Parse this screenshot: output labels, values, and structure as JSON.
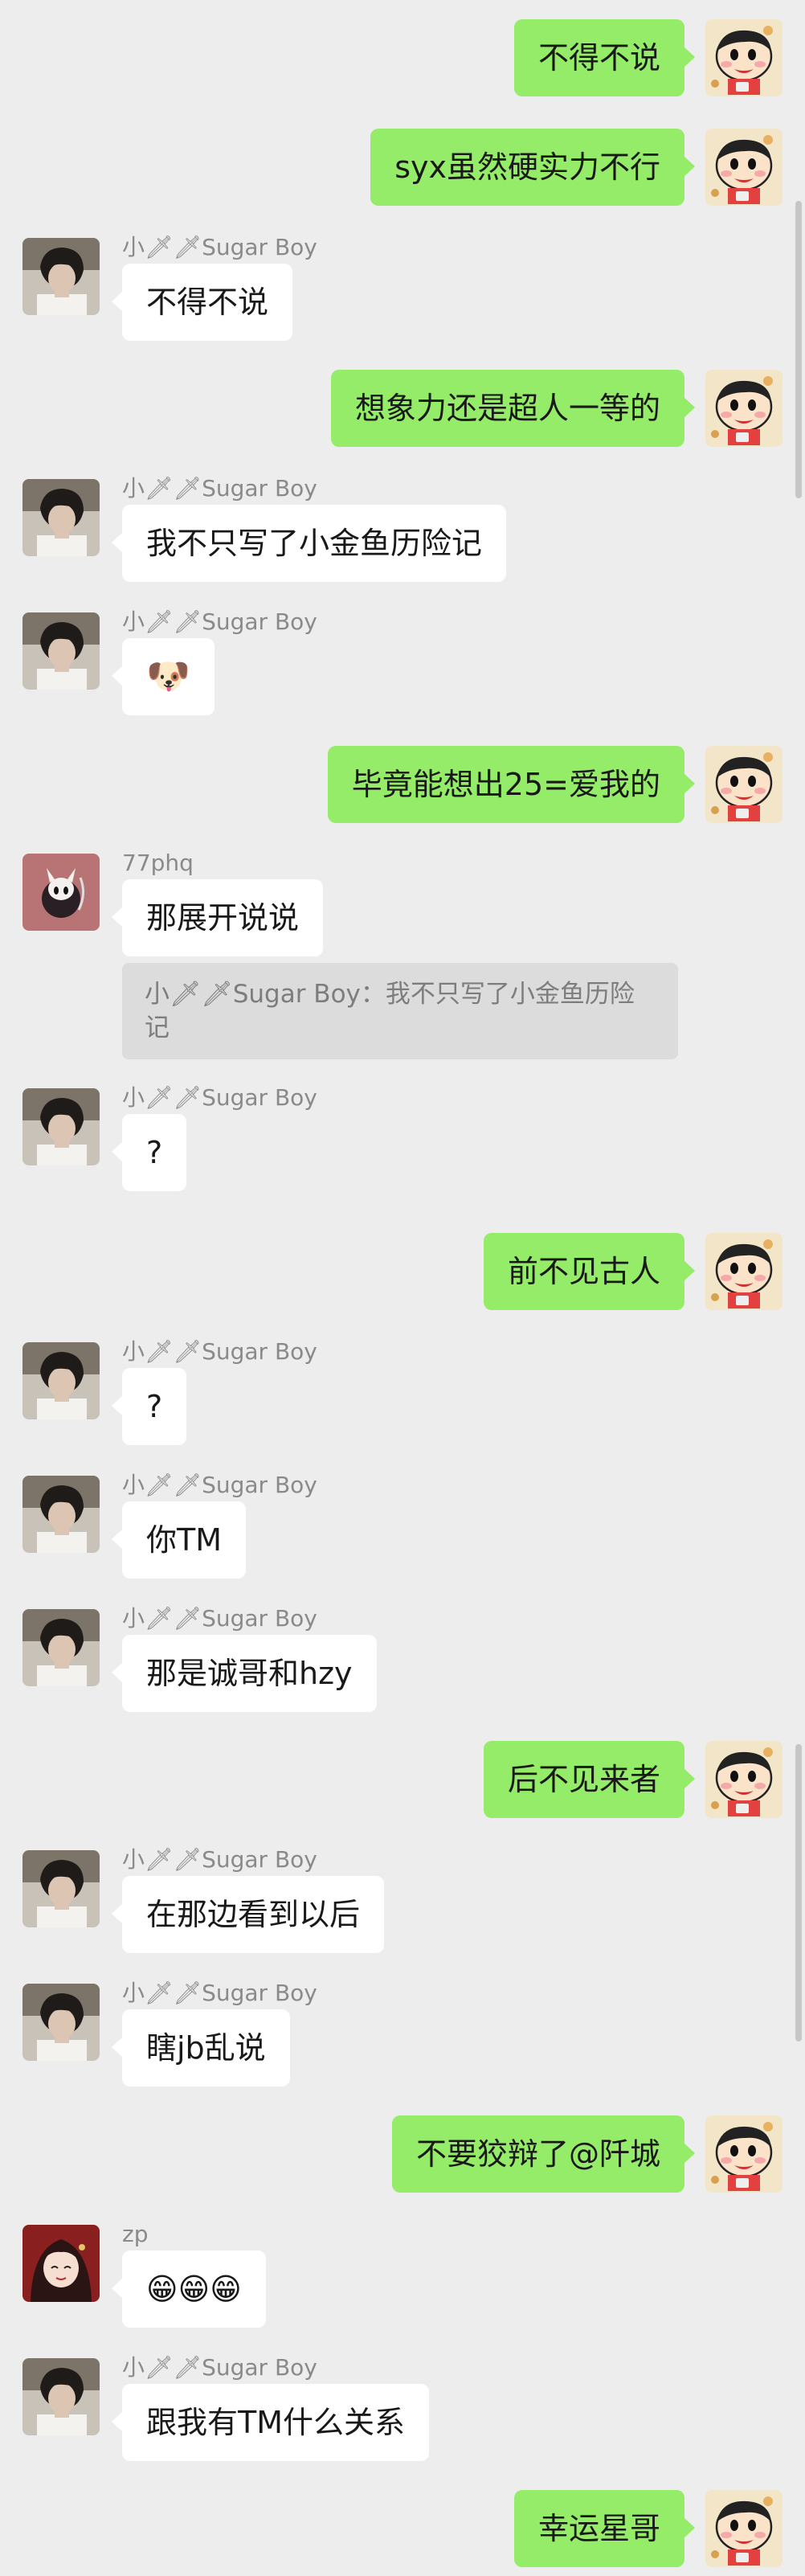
{
  "colors": {
    "background": "#ededed",
    "outgoing_bubble": "#95ec69",
    "incoming_bubble": "#ffffff",
    "name_text": "#8a8a8a"
  },
  "messages": [
    {
      "side": "right",
      "text": "不得不说"
    },
    {
      "side": "right",
      "text": "syx虽然硬实力不行"
    },
    {
      "side": "left",
      "sender": "小🗡🗡Sugar Boy",
      "text": "不得不说"
    },
    {
      "side": "right",
      "text": "想象力还是超人一等的"
    },
    {
      "side": "left",
      "sender": "小🗡🗡Sugar Boy",
      "text": "我不只写了小金鱼历险记"
    },
    {
      "side": "left",
      "sender": "小🗡🗡Sugar Boy",
      "text": "🐶"
    },
    {
      "side": "right",
      "text": "毕竟能想出25=爱我的"
    },
    {
      "side": "left",
      "sender": "77phq",
      "text": "那展开说说",
      "quote": "小🗡🗡Sugar Boy：我不只写了小金鱼历险记"
    },
    {
      "side": "left",
      "sender": "小🗡🗡Sugar Boy",
      "text": "?"
    },
    {
      "side": "right",
      "text": "前不见古人"
    },
    {
      "side": "left",
      "sender": "小🗡🗡Sugar Boy",
      "text": "?"
    },
    {
      "side": "left",
      "sender": "小🗡🗡Sugar Boy",
      "text": "你TM"
    },
    {
      "side": "left",
      "sender": "小🗡🗡Sugar Boy",
      "text": "那是诚哥和hzy"
    },
    {
      "side": "right",
      "text": "后不见来者"
    },
    {
      "side": "left",
      "sender": "小🗡🗡Sugar Boy",
      "text": "在那边看到以后"
    },
    {
      "side": "left",
      "sender": "小🗡🗡Sugar Boy",
      "text": "瞎jb乱说"
    },
    {
      "side": "right",
      "text": "不要狡辩了@阡城"
    },
    {
      "side": "left",
      "sender": "zp",
      "text": "😁😁😁"
    },
    {
      "side": "left",
      "sender": "小🗡🗡Sugar Boy",
      "text": "跟我有TM什么关系"
    },
    {
      "side": "right",
      "text": "幸运星哥"
    }
  ]
}
